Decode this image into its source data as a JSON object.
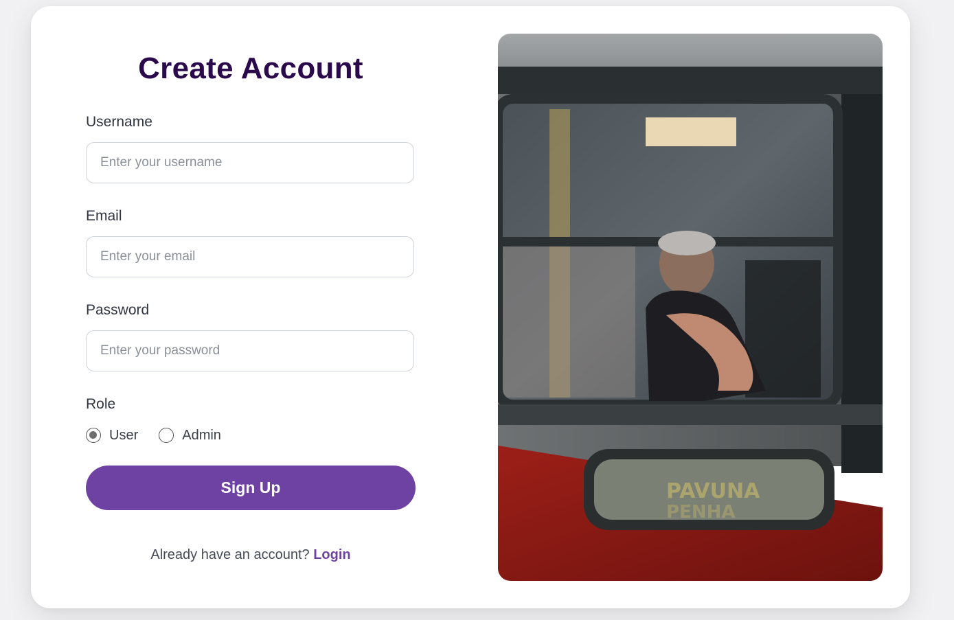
{
  "form": {
    "title": "Create Account",
    "username_label": "Username",
    "username_placeholder": "Enter your username",
    "username_value": "",
    "email_label": "Email",
    "email_placeholder": "Enter your email",
    "email_value": "",
    "password_label": "Password",
    "password_placeholder": "Enter your password",
    "password_value": "",
    "role_label": "Role",
    "role_options": [
      {
        "label": "User",
        "checked": true
      },
      {
        "label": "Admin",
        "checked": false
      }
    ],
    "submit_label": "Sign Up",
    "footer_prompt": "Already have an account?",
    "footer_link": "Login"
  },
  "photo": {
    "sign_text_line1": "PAVUNA",
    "sign_text_line2": "PENHA"
  },
  "colors": {
    "accent": "#6e42a3",
    "title": "#2a0a4a",
    "bus_red": "#8e1a15",
    "bus_gray": "#8a8d8e"
  }
}
